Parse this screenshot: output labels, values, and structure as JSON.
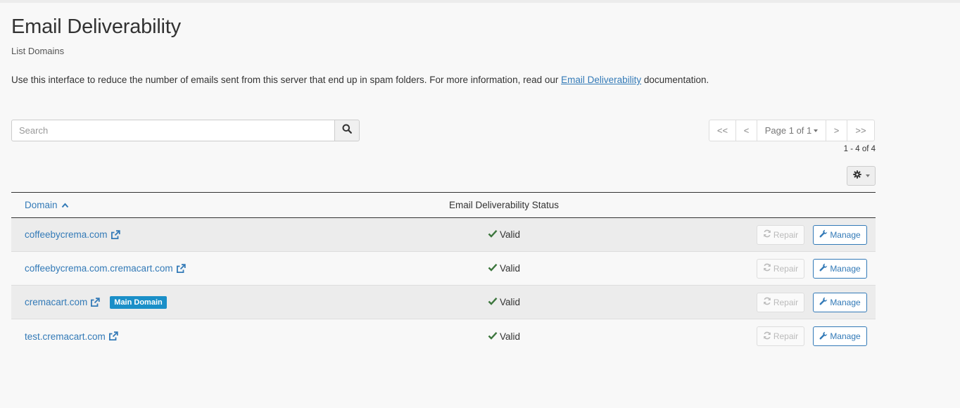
{
  "header": {
    "title": "Email Deliverability",
    "subtitle": "List Domains"
  },
  "intro": {
    "text_before": "Use this interface to reduce the number of emails sent from this server that end up in spam folders. For more information, read our ",
    "link_text": "Email Deliverability",
    "text_after": " documentation."
  },
  "search": {
    "placeholder": "Search",
    "value": ""
  },
  "pagination": {
    "first": "<<",
    "prev": "<",
    "page_label": "Page 1 of 1",
    "next": ">",
    "last": ">>",
    "range": "1 - 4 of 4"
  },
  "table": {
    "columns": {
      "domain": "Domain",
      "status": "Email Deliverability Status"
    },
    "rows": [
      {
        "domain": "coffeebycrema.com",
        "badge": "",
        "status": "Valid",
        "repair_label": "Repair",
        "manage_label": "Manage"
      },
      {
        "domain": "coffeebycrema.com.cremacart.com",
        "badge": "",
        "status": "Valid",
        "repair_label": "Repair",
        "manage_label": "Manage"
      },
      {
        "domain": "cremacart.com",
        "badge": "Main Domain",
        "status": "Valid",
        "repair_label": "Repair",
        "manage_label": "Manage"
      },
      {
        "domain": "test.cremacart.com",
        "badge": "",
        "status": "Valid",
        "repair_label": "Repair",
        "manage_label": "Manage"
      }
    ]
  },
  "icons": {
    "search": "search-icon",
    "gear": "gear-icon",
    "external_link": "external-link-icon",
    "check": "check-icon",
    "refresh": "refresh-icon",
    "wrench": "wrench-icon",
    "sort_up": "chevron-up-icon"
  },
  "colors": {
    "link": "#337ab7",
    "badge": "#1a8fc8",
    "valid": "#3c763d"
  }
}
